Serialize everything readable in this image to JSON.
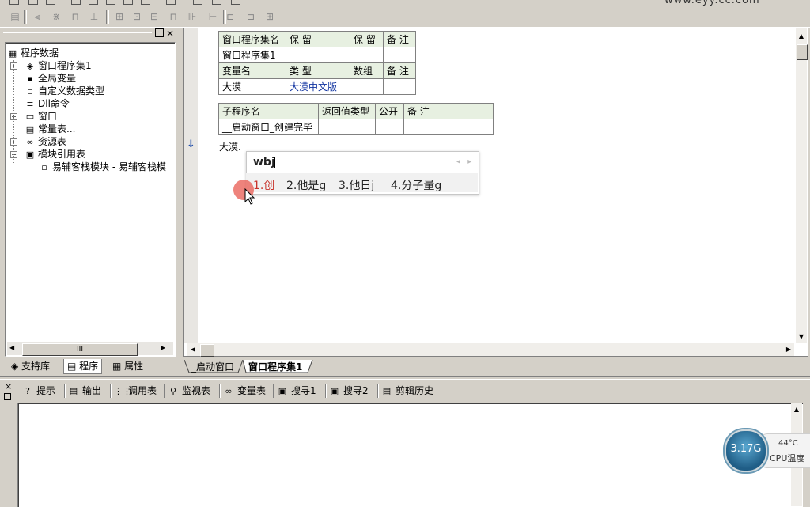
{
  "app": {
    "site_url": "www.eyy.cc.com"
  },
  "toolbar": {
    "top_icons": [
      "copy-icon",
      "edit-icon",
      "undo-icon",
      "redo-icon",
      "cut-icon",
      "paste-icon",
      "find-icon",
      "window-icon",
      "layout-icon",
      "run-icon",
      "stop-icon",
      "build-icon"
    ],
    "icons": [
      "form-icon",
      "align-left-icon",
      "align-center-icon",
      "distribute-icon",
      "align-bottom-icon",
      "center-h-icon",
      "center-v-icon",
      "same-width-icon",
      "same-height-icon",
      "space-h-icon",
      "space-v-icon",
      "size-w-icon",
      "size-h-icon",
      "size-both-icon"
    ]
  },
  "left_panel": {
    "tree": [
      {
        "label": "程序数据",
        "icon": "program-data-icon",
        "glyph": "▦"
      },
      {
        "label": "窗口程序集1",
        "icon": "class-icon",
        "glyph": "◈",
        "expand": "+"
      },
      {
        "label": "全局变量",
        "icon": "global-var-icon",
        "glyph": "▪"
      },
      {
        "label": "自定义数据类型",
        "icon": "custom-type-icon",
        "glyph": "▫"
      },
      {
        "label": "Dll命令",
        "icon": "dll-icon",
        "glyph": "≡"
      },
      {
        "label": "窗口",
        "icon": "window-icon",
        "glyph": "▭",
        "expand": "+"
      },
      {
        "label": "常量表...",
        "icon": "constant-icon",
        "glyph": "▤"
      },
      {
        "label": "资源表",
        "icon": "resource-icon",
        "glyph": "∞",
        "expand": "+"
      },
      {
        "label": "模块引用表",
        "icon": "module-ref-icon",
        "glyph": "▣",
        "expand": "−"
      },
      {
        "label": "易辅客栈模块 - 易辅客栈模",
        "icon": "module-icon",
        "glyph": "▫"
      }
    ],
    "scroll_label": "III",
    "tabs": [
      {
        "label": "支持库",
        "icon": "library-icon",
        "glyph": "◈"
      },
      {
        "label": "程序",
        "icon": "program-icon",
        "glyph": "▤"
      },
      {
        "label": "属性",
        "icon": "property-icon",
        "glyph": "▦"
      }
    ]
  },
  "editor": {
    "assembly_table": {
      "row1": [
        "窗口程序集名",
        "保 留",
        "保 留",
        "备 注"
      ],
      "row2": [
        "窗口程序集1",
        "",
        "",
        ""
      ],
      "row3": [
        "变量名",
        "类 型",
        "数组",
        "备 注"
      ],
      "row4": [
        "大漠",
        "大漠中文版",
        "",
        ""
      ]
    },
    "sub_table": {
      "header": [
        "子程序名",
        "返回值类型",
        "公开",
        "备 注"
      ],
      "row": [
        "__启动窗口_创建完毕",
        "",
        "",
        ""
      ]
    },
    "marker": "↓",
    "typed_text": "大漠."
  },
  "ime": {
    "input": "wbj",
    "nav": "◂ ▸",
    "candidates": [
      "1.创",
      "2.他是g",
      "3.他日j",
      "4.分子量g"
    ]
  },
  "doc_tabs": [
    "_启动窗口",
    "窗口程序集1"
  ],
  "bottom_panel": {
    "tabs": [
      {
        "label": "提示",
        "icon": "hint-icon",
        "glyph": "?"
      },
      {
        "label": "输出",
        "icon": "output-icon",
        "glyph": "▤"
      },
      {
        "label": "调用表",
        "icon": "call-table-icon",
        "glyph": "⋮⋮"
      },
      {
        "label": "监视表",
        "icon": "watch-icon",
        "glyph": "⚲"
      },
      {
        "label": "变量表",
        "icon": "variable-icon",
        "glyph": "∞"
      },
      {
        "label": "搜寻1",
        "icon": "search1-icon",
        "glyph": "▣"
      },
      {
        "label": "搜寻2",
        "icon": "search2-icon",
        "glyph": "▣"
      },
      {
        "label": "剪辑历史",
        "icon": "clip-history-icon",
        "glyph": "▤"
      }
    ]
  },
  "cpu_widget": {
    "speed": "3.17G",
    "temp": "44°C",
    "label": "CPU温度"
  },
  "colors": {
    "table_header": "#e7f0e1",
    "candidate_selected": "#c8342c",
    "type_text": "#1033a0"
  }
}
